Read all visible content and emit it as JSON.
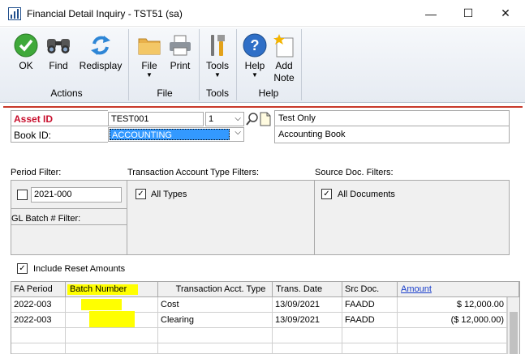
{
  "window": {
    "title": "Financial Detail Inquiry  -  TST51 (sa)",
    "minimize": "—",
    "maximize": "☐",
    "close": "✕"
  },
  "ribbon": {
    "ok": "OK",
    "find": "Find",
    "redisplay": "Redisplay",
    "file": "File",
    "print": "Print",
    "tools": "Tools",
    "help": "Help",
    "add_note_1": "Add",
    "add_note_2": "Note",
    "groups": {
      "actions": "Actions",
      "file": "File",
      "tools": "Tools",
      "help": "Help"
    }
  },
  "header": {
    "asset_id_label": "Asset ID",
    "asset_id_value": "TEST001",
    "asset_suffix": "1",
    "asset_description": "Test Only",
    "book_id_label": "Book ID:",
    "book_id_value": "ACCOUNTING",
    "book_description": "Accounting Book"
  },
  "filters": {
    "period_filter_label": "Period Filter:",
    "period_value": "2021-000",
    "period_checked": false,
    "gl_batch_label": "GL Batch # Filter:",
    "trx_type_label": "Transaction Account Type Filters:",
    "all_types_label": "All Types",
    "all_types_checked": true,
    "source_doc_label": "Source Doc. Filters:",
    "all_documents_label": "All Documents",
    "all_documents_checked": true,
    "include_reset_label": "Include Reset Amounts",
    "include_reset_checked": true
  },
  "grid": {
    "columns": [
      "FA Period",
      "Batch Number",
      "Transaction Acct. Type",
      "Trans. Date",
      "Src Doc.",
      "Amount"
    ],
    "rows": [
      {
        "fa_period": "2022-003",
        "batch_number": "",
        "trx_type": "Cost",
        "trans_date": "13/09/2021",
        "src_doc": "FAADD",
        "amount": "$ 12,000.00"
      },
      {
        "fa_period": "2022-003",
        "batch_number": "",
        "trx_type": "Clearing",
        "trans_date": "13/09/2021",
        "src_doc": "FAADD",
        "amount": "($ 12,000.00)"
      }
    ]
  },
  "colors": {
    "highlight": "#ffff00",
    "required_label": "#c8102e",
    "selection": "#3399ff"
  }
}
